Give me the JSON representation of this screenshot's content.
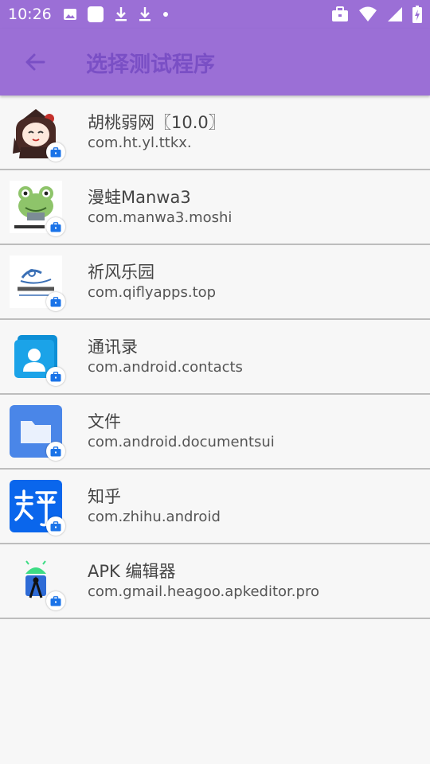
{
  "status_bar": {
    "time": "10:26",
    "left_icons": [
      "image-icon",
      "square-notification-icon",
      "download-icon",
      "download-icon",
      "dot-icon"
    ],
    "right_icons": [
      "briefcase-icon",
      "wifi-icon",
      "signal-icon",
      "battery-charging-icon"
    ]
  },
  "app_bar": {
    "title": "选择测试程序",
    "back_icon": "arrow-back-icon"
  },
  "apps": [
    {
      "name": "胡桃弱网〖10.0〗",
      "package": "com.ht.yl.ttkx.",
      "icon": "hutao-character-icon"
    },
    {
      "name": "漫蛙Manwa3",
      "package": "com.manwa3.moshi",
      "icon": "frog-icon"
    },
    {
      "name": "祈风乐园",
      "package": "com.qiflyapps.top",
      "icon": "qifeng-logo-icon"
    },
    {
      "name": "通讯录",
      "package": "com.android.contacts",
      "icon": "contacts-icon"
    },
    {
      "name": "文件",
      "package": "com.android.documentsui",
      "icon": "folder-icon"
    },
    {
      "name": "知乎",
      "package": "com.zhihu.android",
      "icon": "zhihu-icon"
    },
    {
      "name": "APK 编辑器",
      "package": "com.gmail.heagoo.apkeditor.pro",
      "icon": "apk-editor-icon"
    }
  ],
  "colors": {
    "primary": "#9b6fd6",
    "title": "#7a4fc5",
    "divider": "#bdbdbd",
    "background": "#f7f7f7",
    "badge": "#1a73e8"
  }
}
